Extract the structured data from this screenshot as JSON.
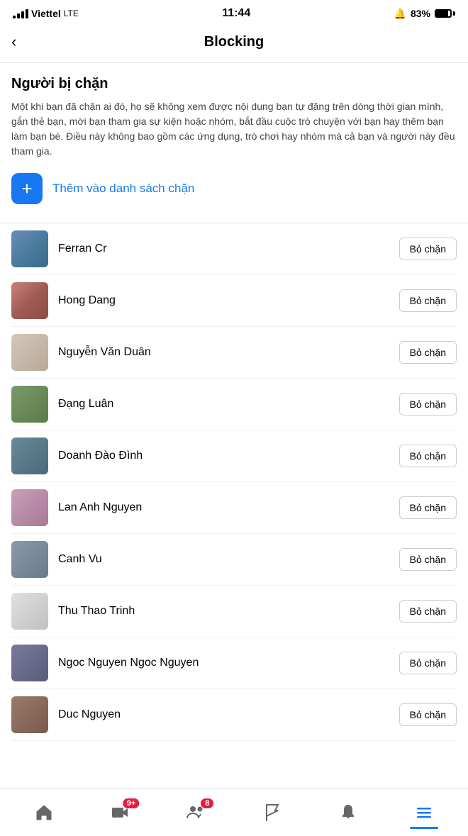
{
  "status": {
    "carrier": "Viettel",
    "network": "LTE",
    "time": "11:44",
    "battery_percent": "83%"
  },
  "header": {
    "back_label": "‹",
    "title": "Blocking"
  },
  "section": {
    "title": "Người bị chặn",
    "description": "Một khi bạn đã chặn ai đó, họ sẽ không xem được nội dung bạn tự đăng trên dòng thời gian mình, gắn thẻ bạn, mời bạn tham gia sự kiện hoặc nhóm, bắt đầu cuộc trò chuyện với bạn hay thêm bạn làm bạn bè. Điều này không bao gồm các ứng dụng, trò chơi hay nhóm mà cả bạn và người này đều tham gia.",
    "add_label": "Thêm vào danh sách chặn"
  },
  "blocked_users": [
    {
      "name": "Ferran Cr",
      "avatar_class": "avatar-1",
      "unblock_label": "Bỏ chặn"
    },
    {
      "name": "Hong Dang",
      "avatar_class": "avatar-2",
      "unblock_label": "Bỏ chặn"
    },
    {
      "name": "Nguyễn Văn Duân",
      "avatar_class": "avatar-3",
      "unblock_label": "Bỏ chặn"
    },
    {
      "name": "Đạng Luân",
      "avatar_class": "avatar-4",
      "unblock_label": "Bỏ chặn"
    },
    {
      "name": "Doanh Đào Đình",
      "avatar_class": "avatar-5",
      "unblock_label": "Bỏ chặn"
    },
    {
      "name": "Lan Anh Nguyen",
      "avatar_class": "avatar-6",
      "unblock_label": "Bỏ chặn"
    },
    {
      "name": "Canh Vu",
      "avatar_class": "avatar-7",
      "unblock_label": "Bỏ chặn"
    },
    {
      "name": "Thu Thao Trinh",
      "avatar_class": "avatar-8",
      "unblock_label": "Bỏ chặn"
    },
    {
      "name": "Ngoc Nguyen Ngoc Nguyen",
      "avatar_class": "avatar-9",
      "unblock_label": "Bỏ chặn"
    },
    {
      "name": "Duc Nguyen",
      "avatar_class": "avatar-10",
      "unblock_label": "Bỏ chặn"
    }
  ],
  "bottom_nav": {
    "items": [
      {
        "name": "home",
        "label": "Home",
        "badge": null,
        "active": false
      },
      {
        "name": "video",
        "label": "Video",
        "badge": "9+",
        "active": false
      },
      {
        "name": "friends",
        "label": "Friends",
        "badge": "8",
        "active": false
      },
      {
        "name": "flag",
        "label": "Flag",
        "badge": null,
        "active": false
      },
      {
        "name": "bell",
        "label": "Notifications",
        "badge": null,
        "active": false
      },
      {
        "name": "menu",
        "label": "Menu",
        "badge": null,
        "active": true
      }
    ]
  }
}
